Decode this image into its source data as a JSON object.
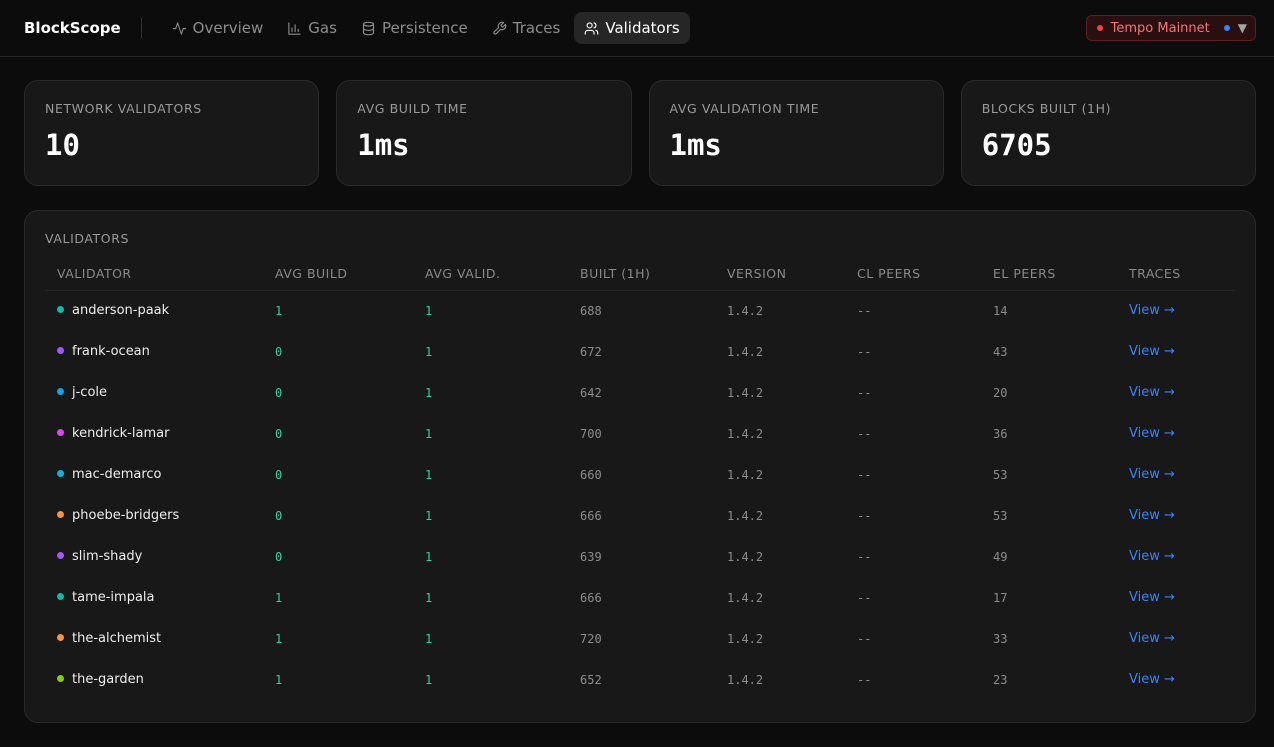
{
  "app": {
    "brand": "BlockScope"
  },
  "nav": [
    {
      "label": "Overview",
      "icon": "activity-icon",
      "active": false
    },
    {
      "label": "Gas",
      "icon": "bar-chart-icon",
      "active": false
    },
    {
      "label": "Persistence",
      "icon": "database-icon",
      "active": false
    },
    {
      "label": "Traces",
      "icon": "wrench-icon",
      "active": false
    },
    {
      "label": "Validators",
      "icon": "users-icon",
      "active": true
    }
  ],
  "network": {
    "label": "Tempo Mainnet",
    "caret": "▼",
    "colors": {
      "status": "#ef4444",
      "secondary": "#3b82f6"
    }
  },
  "stats": [
    {
      "label": "NETWORK VALIDATORS",
      "value": "10"
    },
    {
      "label": "AVG BUILD TIME",
      "value": "1ms"
    },
    {
      "label": "AVG VALIDATION TIME",
      "value": "1ms"
    },
    {
      "label": "BLOCKS BUILT (1H)",
      "value": "6705"
    }
  ],
  "validators": {
    "title": "VALIDATORS",
    "columns": [
      "VALIDATOR",
      "AVG BUILD",
      "AVG VALID.",
      "BUILT (1H)",
      "VERSION",
      "CL PEERS",
      "EL PEERS",
      "TRACES"
    ],
    "rows": [
      {
        "name": "anderson-paak",
        "color": "#14b8a6",
        "avg_build": "1",
        "avg_valid": "1",
        "built": "688",
        "version": "1.4.2",
        "cl_peers": "--",
        "el_peers": "14",
        "traces": "View →"
      },
      {
        "name": "frank-ocean",
        "color": "#a855f7",
        "avg_build": "0",
        "avg_valid": "1",
        "built": "672",
        "version": "1.4.2",
        "cl_peers": "--",
        "el_peers": "43",
        "traces": "View →"
      },
      {
        "name": "j-cole",
        "color": "#0ea5e9",
        "avg_build": "0",
        "avg_valid": "1",
        "built": "642",
        "version": "1.4.2",
        "cl_peers": "--",
        "el_peers": "20",
        "traces": "View →"
      },
      {
        "name": "kendrick-lamar",
        "color": "#d946ef",
        "avg_build": "0",
        "avg_valid": "1",
        "built": "700",
        "version": "1.4.2",
        "cl_peers": "--",
        "el_peers": "36",
        "traces": "View →"
      },
      {
        "name": "mac-demarco",
        "color": "#06b6d4",
        "avg_build": "0",
        "avg_valid": "1",
        "built": "660",
        "version": "1.4.2",
        "cl_peers": "--",
        "el_peers": "53",
        "traces": "View →"
      },
      {
        "name": "phoebe-bridgers",
        "color": "#fb923c",
        "avg_build": "0",
        "avg_valid": "1",
        "built": "666",
        "version": "1.4.2",
        "cl_peers": "--",
        "el_peers": "53",
        "traces": "View →"
      },
      {
        "name": "slim-shady",
        "color": "#a855f7",
        "avg_build": "0",
        "avg_valid": "1",
        "built": "639",
        "version": "1.4.2",
        "cl_peers": "--",
        "el_peers": "49",
        "traces": "View →"
      },
      {
        "name": "tame-impala",
        "color": "#14b8a6",
        "avg_build": "1",
        "avg_valid": "1",
        "built": "666",
        "version": "1.4.2",
        "cl_peers": "--",
        "el_peers": "17",
        "traces": "View →"
      },
      {
        "name": "the-alchemist",
        "color": "#fb923c",
        "avg_build": "1",
        "avg_valid": "1",
        "built": "720",
        "version": "1.4.2",
        "cl_peers": "--",
        "el_peers": "33",
        "traces": "View →"
      },
      {
        "name": "the-garden",
        "color": "#84cc16",
        "avg_build": "1",
        "avg_valid": "1",
        "built": "652",
        "version": "1.4.2",
        "cl_peers": "--",
        "el_peers": "23",
        "traces": "View →"
      }
    ]
  }
}
